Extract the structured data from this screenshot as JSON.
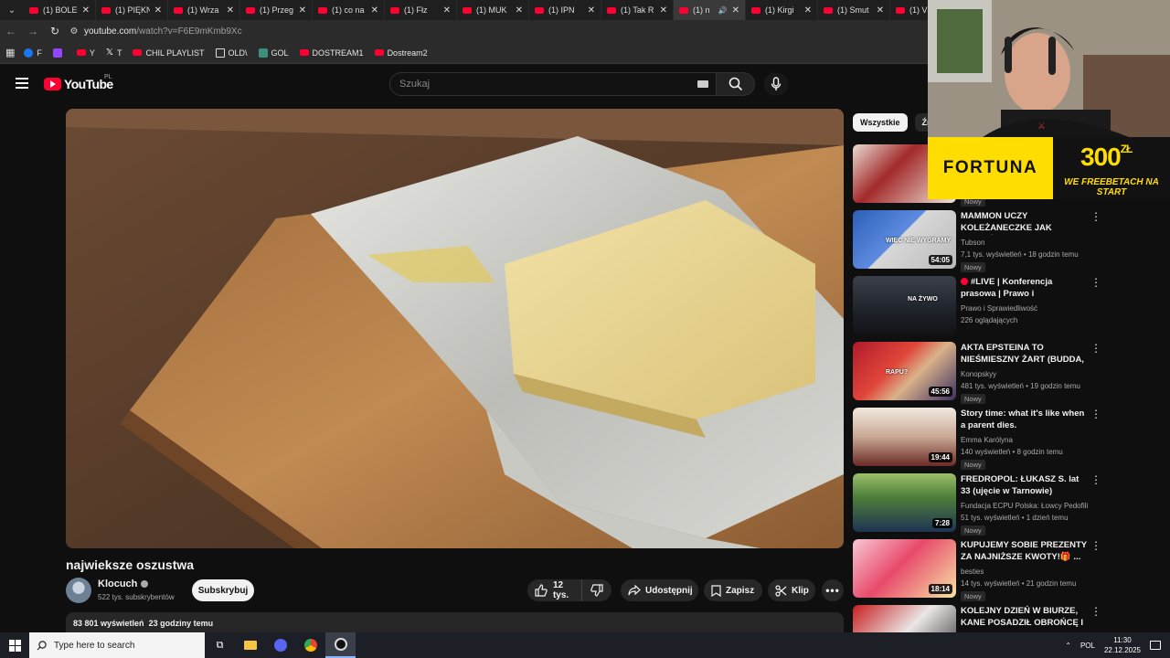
{
  "browser": {
    "tabs": [
      {
        "label": "(1) BOLE"
      },
      {
        "label": "(1) PIĘKN"
      },
      {
        "label": "(1) Wrza"
      },
      {
        "label": "(1) Przeg"
      },
      {
        "label": "(1) co na"
      },
      {
        "label": "(1) Fłz"
      },
      {
        "label": "(1) MUK"
      },
      {
        "label": "(1) IPN"
      },
      {
        "label": "(1) Tak R"
      },
      {
        "label": "(1) n"
      },
      {
        "label": "(1) Kirgi"
      },
      {
        "label": "(1) Smut"
      },
      {
        "label": "(1) V"
      }
    ],
    "address": {
      "host": "youtube.com",
      "path": "/watch?v=F6E9mKmb9Xc"
    },
    "bookmarks": [
      {
        "label": "F",
        "icon": "facebook-icon"
      },
      {
        "label": "",
        "icon": "twitch-icon"
      },
      {
        "label": "Y",
        "icon": "youtube-icon"
      },
      {
        "label": "T",
        "icon": "x-icon"
      },
      {
        "label": "CHIL PLAYLIST",
        "icon": "youtube-icon"
      },
      {
        "label": "OLD\\",
        "icon": "folder-icon"
      },
      {
        "label": "GOL",
        "icon": "bookmark-icon"
      },
      {
        "label": "DOSTREAM1",
        "icon": "youtube-icon"
      },
      {
        "label": "Dostream2",
        "icon": "youtube-icon"
      }
    ]
  },
  "youtube": {
    "logo_text": "YouTube",
    "region": "PL",
    "search_placeholder": "Szukaj"
  },
  "video": {
    "title": "najwieksze oszustwa",
    "channel": "Klocuch",
    "subscribers": "522 tys. subskrybentów",
    "subscribe_label": "Subskrybuj",
    "likes": "12 tys.",
    "share_label": "Udostępnij",
    "save_label": "Zapisz",
    "clip_label": "Klip",
    "views": "83 801 wyświetleń",
    "posted": "23 godziny temu"
  },
  "sidebar": {
    "chips": [
      {
        "label": "Wszystkie"
      },
      {
        "label": "Źr"
      }
    ],
    "recommendations": [
      {
        "title": "",
        "channel": "",
        "meta": "",
        "badge": "Nowy",
        "duration": "",
        "live": false
      },
      {
        "title": "MAMMON UCZY KOLEŻANECZKE JAK WYGAĆ ...",
        "channel": "Tubson",
        "meta": "7,1 tys. wyświetleń • 18 godzin temu",
        "badge": "Nowy",
        "duration": "54:05",
        "live": false,
        "thumb_text": "WIĘC NIE WYGRAMY"
      },
      {
        "title": "#LIVE | Konferencja prasowa | Prawo i Sprawiedliwość",
        "channel": "Prawo i Sprawiedliwość",
        "meta": "226 oglądających",
        "badge": "",
        "duration": "",
        "live": true,
        "thumb_text": "NA ŻYWO"
      },
      {
        "title": "AKTA EPSTEINA TO NIEŚMIESZNY ŻART (BUDDA, ...",
        "channel": "Konopskyy",
        "meta": "481 tys. wyświetleń • 19 godzin temu",
        "badge": "Nowy",
        "duration": "45:56",
        "live": false,
        "thumb_text": "RAPU?"
      },
      {
        "title": "Story time: what it's like when a parent dies.",
        "channel": "Emma Karólyna",
        "meta": "140 wyświetleń • 8 godzin temu",
        "badge": "Nowy",
        "duration": "19:44",
        "live": false
      },
      {
        "title": "FREDROPOL: ŁUKASZ S. lat 33 (ujęcie w Tarnowie)",
        "channel": "Fundacja ECPU Polska: Łowcy Pedofili",
        "meta": "51 tys. wyświetleń • 1 dzień temu",
        "badge": "Nowy",
        "duration": "7:28",
        "live": false
      },
      {
        "title": "KUPUJEMY SOBIE PREZENTY ZA NAJNIŻSZE KWOTY!🎁 ...",
        "channel": "besties",
        "meta": "14 tys. wyświetleń • 21 godzin temu",
        "badge": "Nowy",
        "duration": "18:14",
        "live": false
      },
      {
        "title": "KOLEJNY DZIEŃ W BIURZE, KANE POSADZIŁ OBROŃCĘ I ...",
        "channel": "",
        "meta": "",
        "badge": "",
        "duration": "",
        "live": false
      }
    ]
  },
  "ad": {
    "brand": "FORTUNA",
    "amount": "300",
    "currency": "ZŁ",
    "tagline": "WE FREEBETACH NA START"
  },
  "taskbar": {
    "search_placeholder": "Type here to search",
    "language": "POL",
    "time": "11:30",
    "date": "22.12.2025"
  },
  "colors": {
    "youtube_red": "#ff0033",
    "background": "#0f0f0f",
    "ad_yellow": "#ffdd00"
  }
}
